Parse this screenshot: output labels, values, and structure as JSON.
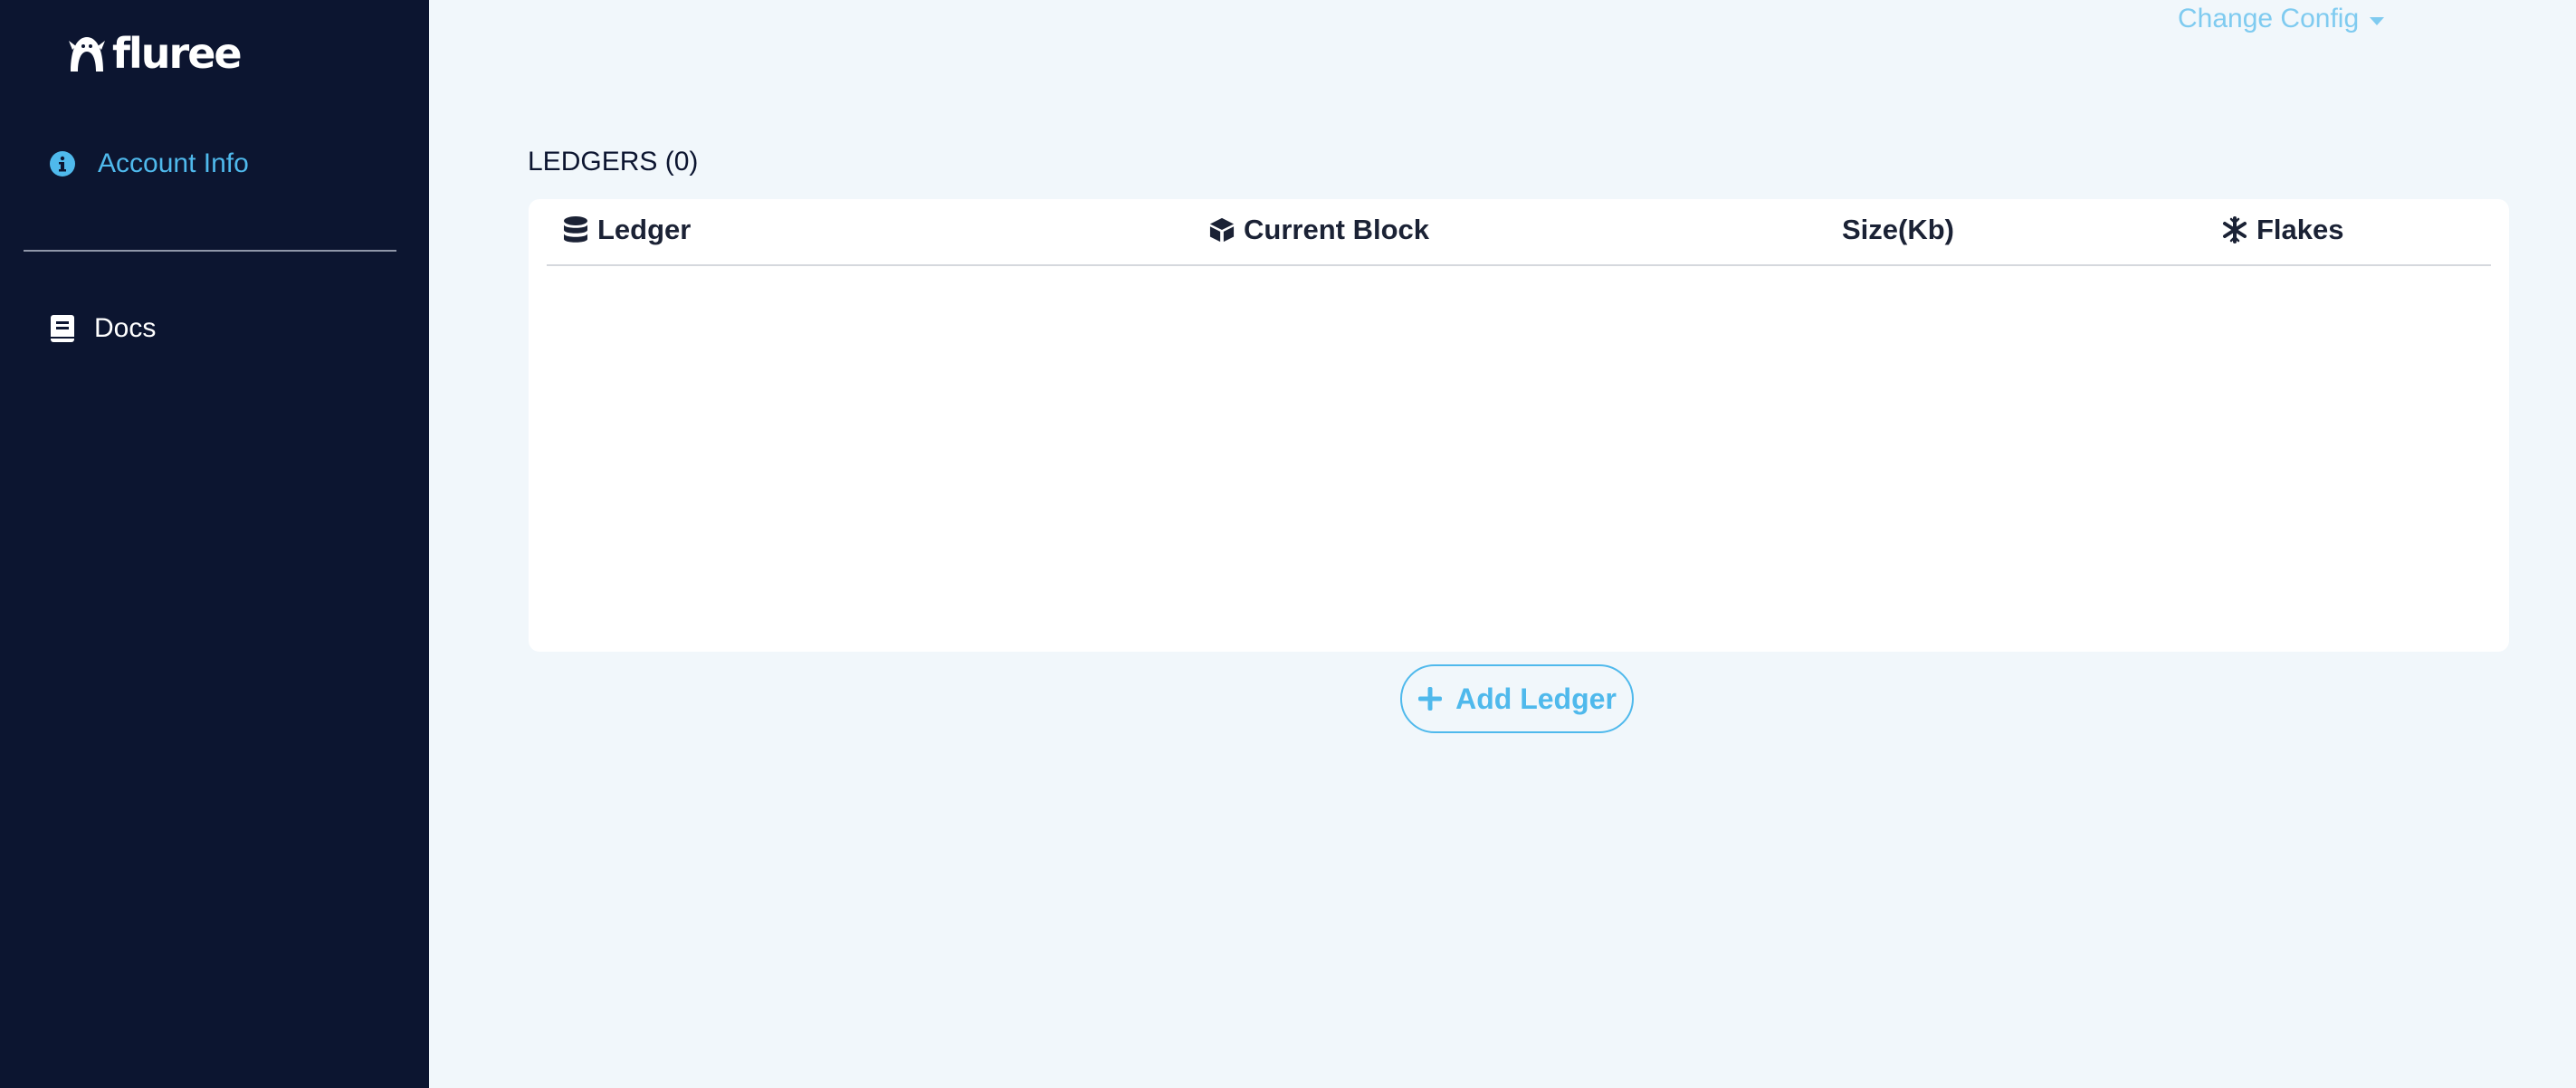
{
  "brand": {
    "name": "fluree"
  },
  "sidebar": {
    "items": [
      {
        "label": "Account Info",
        "icon": "info-circle-icon",
        "active": true
      },
      {
        "label": "Docs",
        "icon": "book-icon",
        "active": false
      }
    ]
  },
  "header": {
    "config_label": "Change Config"
  },
  "main": {
    "title": "LEDGERS (0)",
    "table": {
      "columns": [
        {
          "label": "Ledger",
          "icon": "database-icon"
        },
        {
          "label": "Current Block",
          "icon": "cube-icon"
        },
        {
          "label": "Size(Kb)",
          "icon": ""
        },
        {
          "label": "Flakes",
          "icon": "snowflake-icon"
        }
      ],
      "rows": []
    },
    "add_button_label": "Add Ledger"
  },
  "colors": {
    "sidebar_bg": "#0c1530",
    "page_bg": "#f1f7fb",
    "accent": "#4fb9ec"
  }
}
